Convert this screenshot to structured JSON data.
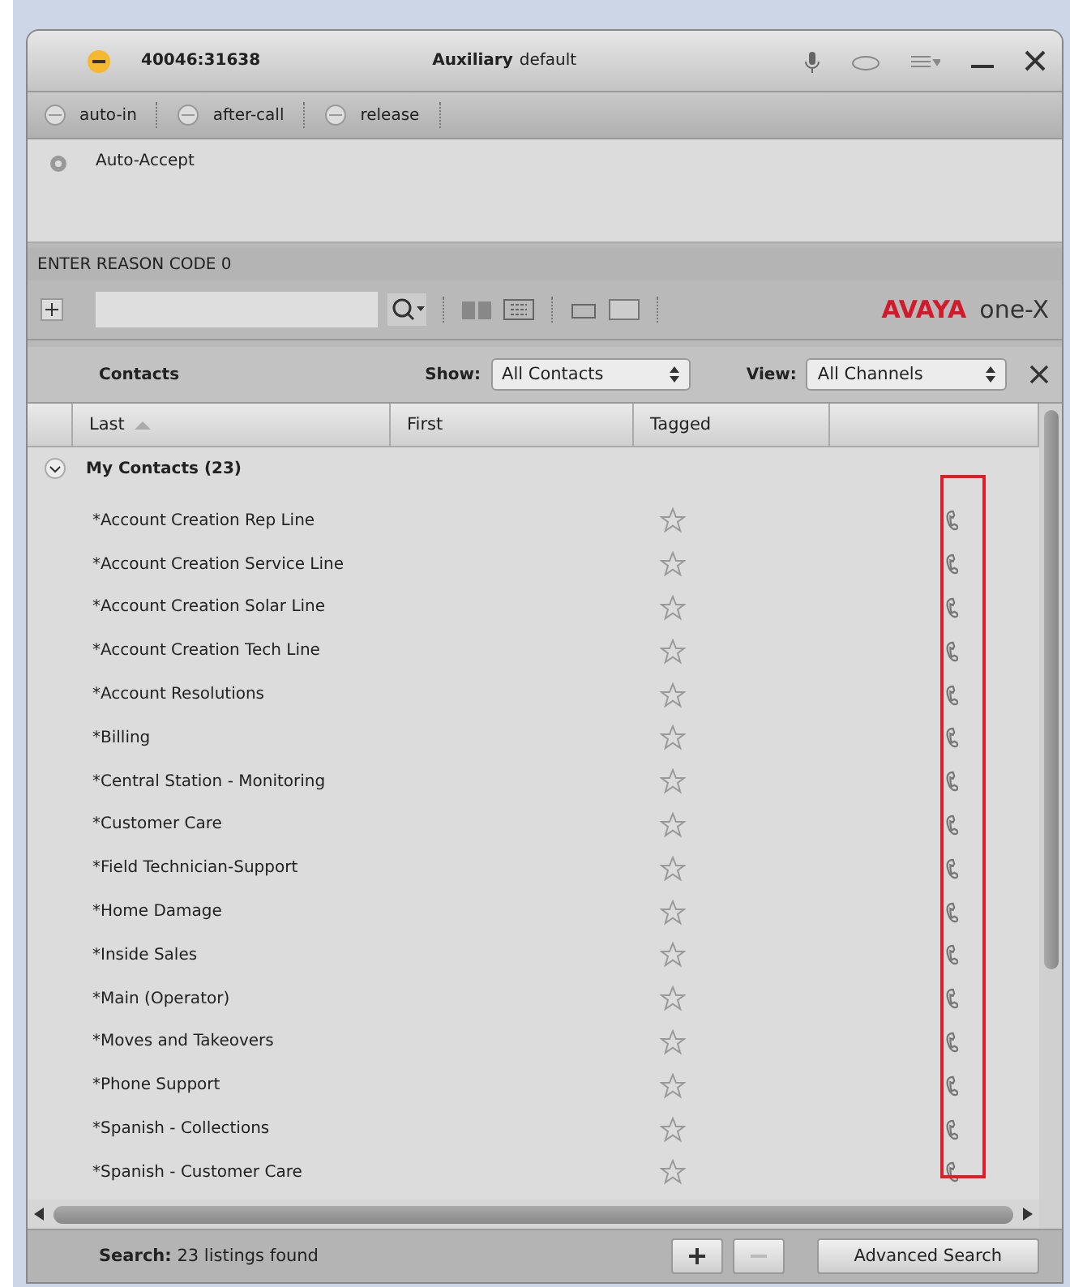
{
  "title_bar": {
    "extension": "40046:31638",
    "state_label": "Auxiliary",
    "state_value": "default"
  },
  "work_modes": [
    {
      "label": "auto-in"
    },
    {
      "label": "after-call"
    },
    {
      "label": "release"
    }
  ],
  "auto_accept": {
    "label": "Auto-Accept"
  },
  "reason_code": "ENTER REASON CODE 0",
  "brand": {
    "left": "AVAYA",
    "right": "one-X"
  },
  "contacts_header": {
    "title": "Contacts",
    "show_label": "Show:",
    "show_value": "All Contacts",
    "view_label": "View:",
    "view_value": "All Channels"
  },
  "table": {
    "columns": [
      {
        "label": "Last",
        "sorted": true
      },
      {
        "label": "First",
        "sorted": false
      },
      {
        "label": "Tagged",
        "sorted": false
      }
    ],
    "group": {
      "label": "My Contacts (23)",
      "expanded": true
    },
    "highlight_phone_column": true,
    "rows": [
      {
        "last": "*Account Creation Rep Line",
        "tagged": false
      },
      {
        "last": "*Account Creation Service Line",
        "tagged": false
      },
      {
        "last": "*Account Creation Solar Line",
        "tagged": false
      },
      {
        "last": "*Account Creation Tech Line",
        "tagged": false
      },
      {
        "last": "*Account Resolutions",
        "tagged": false
      },
      {
        "last": "*Billing",
        "tagged": false
      },
      {
        "last": "*Central Station - Monitoring",
        "tagged": false
      },
      {
        "last": "*Customer Care",
        "tagged": false
      },
      {
        "last": "*Field Technician-Support",
        "tagged": false
      },
      {
        "last": "*Home Damage",
        "tagged": false
      },
      {
        "last": "*Inside Sales",
        "tagged": false
      },
      {
        "last": "*Main (Operator)",
        "tagged": false
      },
      {
        "last": "*Moves and Takeovers",
        "tagged": false
      },
      {
        "last": "*Phone Support",
        "tagged": false
      },
      {
        "last": "*Spanish - Collections",
        "tagged": false
      },
      {
        "last": "*Spanish - Customer Care",
        "tagged": false
      }
    ]
  },
  "footer": {
    "search_label": "Search:",
    "search_result": "23 listings found",
    "advanced_button": "Advanced Search"
  }
}
